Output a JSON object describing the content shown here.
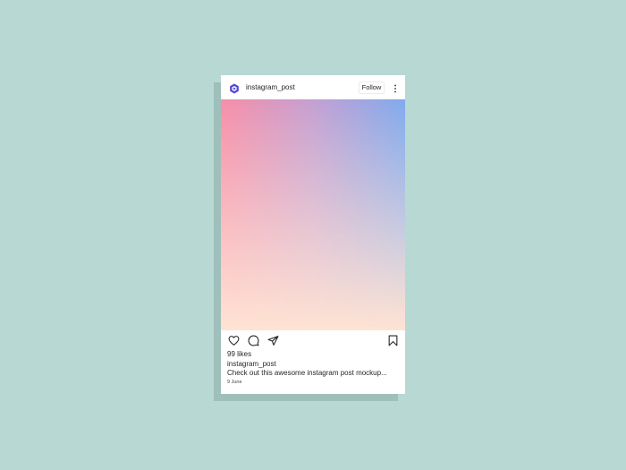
{
  "post": {
    "username": "instagram_post",
    "follow_label": "Follow",
    "likes": "99 likes",
    "caption_user": "instagram_post",
    "caption_text": "Check out this awesome instagram post mockup...",
    "date": "9 June"
  },
  "icons": {
    "avatar": "hexagon-logo-icon",
    "more": "more-vertical-icon",
    "like": "heart-icon",
    "comment": "comment-icon",
    "share": "send-icon",
    "save": "bookmark-icon"
  },
  "colors": {
    "background": "#b8d8d4",
    "card_shadow": "#9ebfba",
    "card": "#ffffff",
    "text": "#262626",
    "avatar_primary": "#5b3fd4",
    "gradient_pink": "#f78ea8",
    "gradient_blue": "#80aaee",
    "gradient_peach": "#ffe3d3"
  }
}
